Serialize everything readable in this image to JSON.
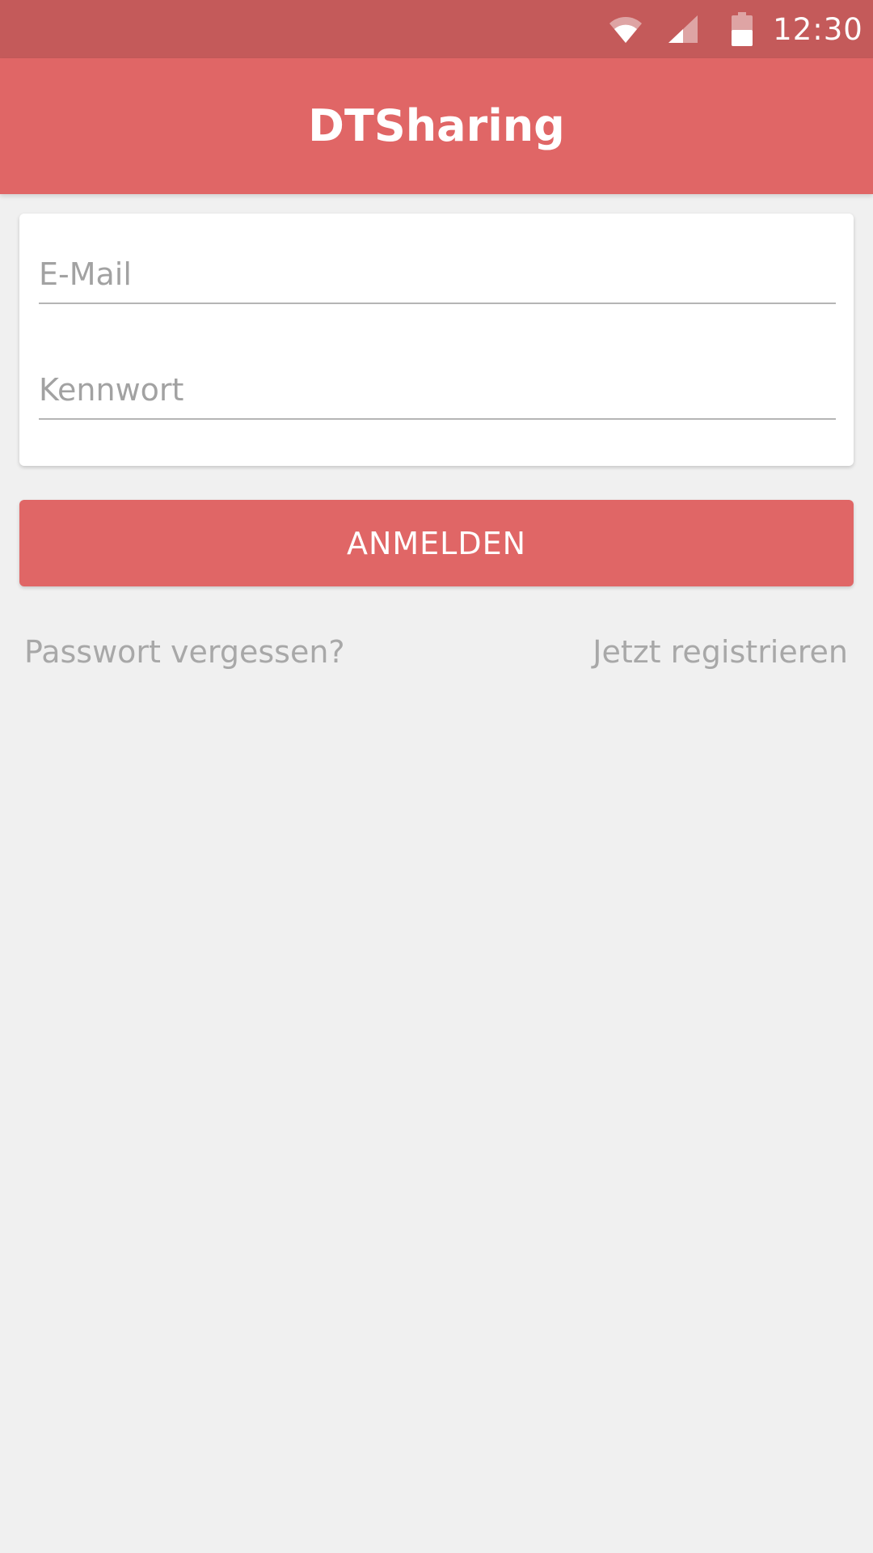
{
  "status_bar": {
    "time": "12:30",
    "icons": [
      "wifi-icon",
      "cell-signal-icon",
      "battery-icon"
    ]
  },
  "app_bar": {
    "title": "DTSharing"
  },
  "login_form": {
    "email_placeholder": "E-Mail",
    "email_value": "",
    "password_placeholder": "Kennwort",
    "password_value": "",
    "submit_label": "ANMELDEN"
  },
  "links": {
    "forgot_password": "Passwort vergessen?",
    "register": "Jetzt registrieren"
  },
  "colors": {
    "primary": "#e06666",
    "status_bar": "#c45a5a",
    "background": "#f0f0f0",
    "hint_text": "#a2a2a2"
  }
}
